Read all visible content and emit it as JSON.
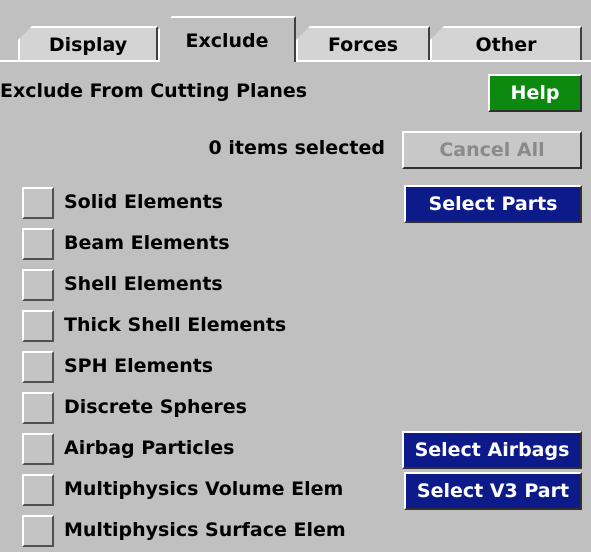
{
  "tabs": [
    {
      "label": "Display"
    },
    {
      "label": "Exclude"
    },
    {
      "label": "Forces"
    },
    {
      "label": "Other"
    }
  ],
  "active_tab": "Exclude",
  "section_title": "Exclude From Cutting Planes",
  "help_label": "Help",
  "selected_count_text": "0 items selected",
  "cancel_all_label": "Cancel All",
  "items": [
    {
      "label": "Solid Elements",
      "checked": false,
      "button": "Select Parts"
    },
    {
      "label": "Beam Elements",
      "checked": false
    },
    {
      "label": "Shell Elements",
      "checked": false
    },
    {
      "label": "Thick Shell Elements",
      "checked": false
    },
    {
      "label": "SPH Elements",
      "checked": false
    },
    {
      "label": "Discrete Spheres",
      "checked": false
    },
    {
      "label": "Airbag Particles",
      "checked": false,
      "button": "Select Airbags"
    },
    {
      "label": "Multiphysics Volume Elem",
      "checked": false,
      "button": "Select V3 Part"
    },
    {
      "label": "Multiphysics Surface Elem",
      "checked": false
    }
  ],
  "colors": {
    "background": "#c0c0c0",
    "help_button": "#0c8a10",
    "select_button": "#0d1a8a",
    "disabled_text": "#8a8a8a"
  }
}
